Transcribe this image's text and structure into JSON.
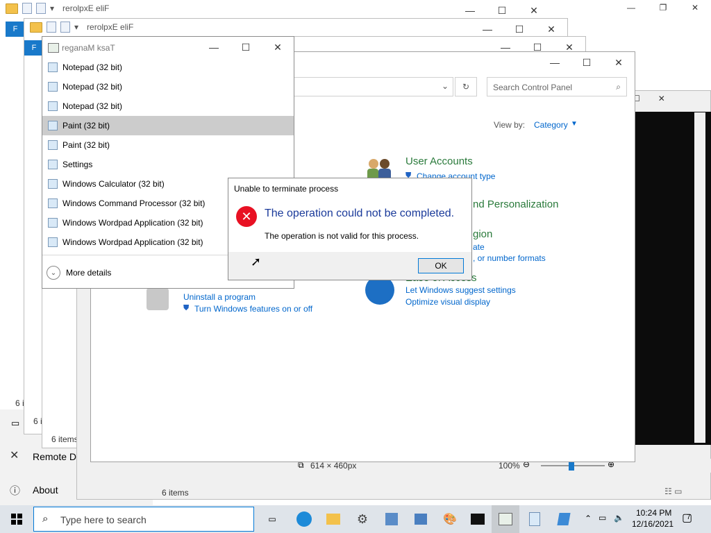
{
  "explorer1": {
    "title": "rerolpxE eliF",
    "file_tab": "F",
    "status": "6 items",
    "status_short": "6 i"
  },
  "explorer2": {
    "title": "rerolpxE eliF",
    "file_tab": "F",
    "status_short": "6 i"
  },
  "settings_bg": {
    "remote_label": "Remote D",
    "about_label": "About"
  },
  "explorer3": {
    "status": "6 items"
  },
  "paint": {
    "size_text": "614 × 460px",
    "zoom": "100%",
    "status": "6 items"
  },
  "control_panel": {
    "search_placeholder": "Search Control Panel",
    "view_by_label": "View by:",
    "view_by_value": "Category",
    "user_accounts": "User Accounts",
    "change_account_type": "Change account type",
    "appearance_partial": "nd Personalization",
    "region_partial": "gion",
    "region_link_partial": "ate",
    "region_link2_partial": ", or number formats",
    "ease_partial": "Ease of Access",
    "ease_link1": "Let Windows suggest settings",
    "ease_link2": "Optimize visual display",
    "uninstall": "Uninstall a program",
    "features": "Turn Windows features on or off"
  },
  "task_manager": {
    "title": "reganaM ksaT",
    "items": [
      {
        "label": "Notepad (32 bit)",
        "icon": "notepad-icon"
      },
      {
        "label": "Notepad (32 bit)",
        "icon": "notepad-icon"
      },
      {
        "label": "Notepad (32 bit)",
        "icon": "notepad-icon"
      },
      {
        "label": "Paint (32 bit)",
        "icon": "paint-icon"
      },
      {
        "label": "Paint (32 bit)",
        "icon": "paint-icon"
      },
      {
        "label": "Settings",
        "icon": "gear-icon"
      },
      {
        "label": "Windows Calculator (32 bit)",
        "icon": "calculator-icon"
      },
      {
        "label": "Windows Command Processor (32 bit)",
        "icon": "cmd-icon"
      },
      {
        "label": "Windows Wordpad Application (32 bit)",
        "icon": "wordpad-icon"
      },
      {
        "label": "Windows Wordpad Application (32 bit)",
        "icon": "wordpad-icon"
      }
    ],
    "more_details": "More details"
  },
  "dialog": {
    "title": "Unable to terminate process",
    "main_text": "The operation could not be completed.",
    "detail_text": "The operation is not valid for this process.",
    "ok_label": "OK"
  },
  "taskbar": {
    "search_placeholder": "Type here to search",
    "time": "10:24 PM",
    "date": "12/16/2021",
    "notification_count": "7"
  },
  "colors": {
    "accent": "#0078d7",
    "link": "#0066cc",
    "error": "#e81123",
    "heading_green": "#2a7a3b"
  }
}
